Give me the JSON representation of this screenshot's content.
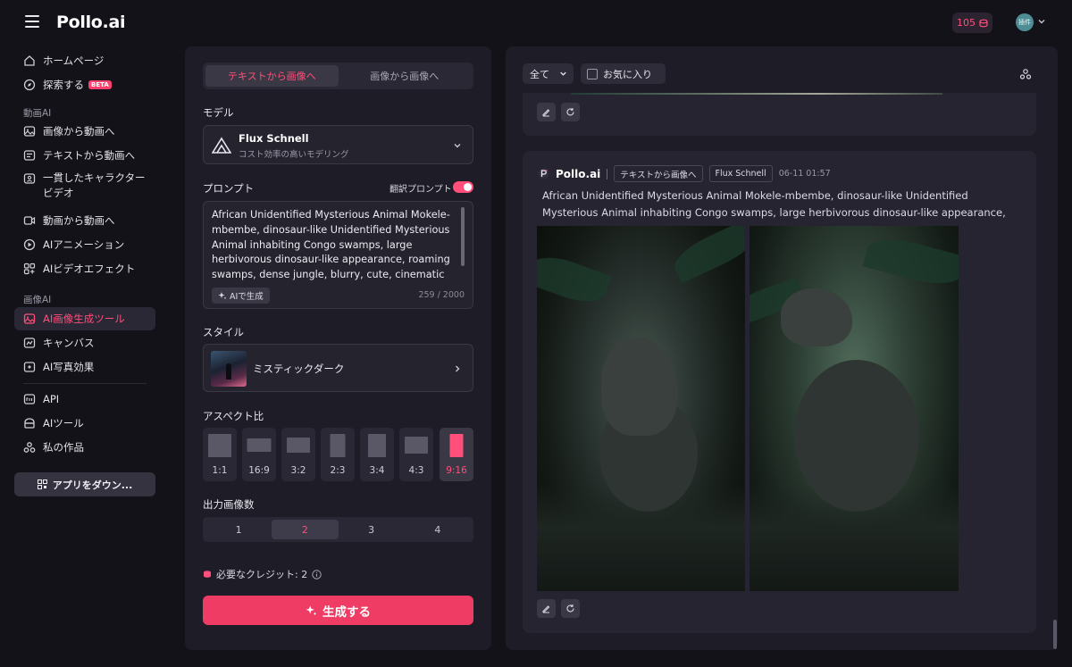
{
  "app": {
    "logo": "Pollo.ai",
    "credits": "105",
    "avatar_text": "插件"
  },
  "sidebar": {
    "items_main": [
      {
        "label": "ホームページ",
        "icon": "home-icon"
      },
      {
        "label": "探索する",
        "icon": "compass-icon",
        "badge": "BETA"
      }
    ],
    "section_video": "動画AI",
    "items_video": [
      {
        "label": "画像から動画へ",
        "icon": "image-to-video-icon"
      },
      {
        "label": "テキストから動画へ",
        "icon": "text-to-video-icon"
      },
      {
        "label": "一貫したキャラクタービデオ",
        "icon": "character-video-icon"
      },
      {
        "label": "動画から動画へ",
        "icon": "video-to-video-icon"
      },
      {
        "label": "AIアニメーション",
        "icon": "animation-icon"
      },
      {
        "label": "AIビデオエフェクト",
        "icon": "effects-icon"
      }
    ],
    "section_image": "画像AI",
    "items_image": [
      {
        "label": "AI画像生成ツール",
        "icon": "image-generator-icon",
        "active": true
      },
      {
        "label": "キャンバス",
        "icon": "canvas-icon"
      },
      {
        "label": "AI写真効果",
        "icon": "photo-effects-icon"
      }
    ],
    "items_bottom": [
      {
        "label": "API",
        "icon": "api-icon"
      },
      {
        "label": "AIツール",
        "icon": "tools-icon"
      },
      {
        "label": "私の作品",
        "icon": "my-works-icon"
      }
    ],
    "download_label": "アプリをダウン..."
  },
  "generator": {
    "tabs": [
      {
        "label": "テキストから画像へ",
        "active": true
      },
      {
        "label": "画像から画像へ",
        "active": false
      }
    ],
    "model_label": "モデル",
    "model_name": "Flux Schnell",
    "model_desc": "コスト効率の高いモデリング",
    "prompt_label": "プロンプト",
    "translate_label": "翻訳プロンプト",
    "translate_on": true,
    "prompt_text": "African Unidentified Mysterious Animal Mokele-mbembe, dinosaur-like Unidentified Mysterious Animal inhabiting Congo swamps, large herbivorous dinosaur-like appearance, roaming swamps, dense jungle, blurry, cute, cinematic",
    "ai_generate_label": "AIで生成",
    "char_count": "259 / 2000",
    "style_label": "スタイル",
    "style_name": "ミスティックダーク",
    "aspect_label": "アスペクト比",
    "aspects": [
      {
        "label": "1:1"
      },
      {
        "label": "16:9"
      },
      {
        "label": "3:2"
      },
      {
        "label": "2:3"
      },
      {
        "label": "3:4"
      },
      {
        "label": "4:3"
      },
      {
        "label": "9:16",
        "active": true
      }
    ],
    "count_label": "出力画像数",
    "counts": [
      "1",
      "2",
      "3",
      "4"
    ],
    "count_selected": "2",
    "credits_required": "必要なクレジット: 2",
    "generate_label": "生成する"
  },
  "results": {
    "filter_all": "全て",
    "filter_fav": "お気に入り",
    "card": {
      "brand": "Pollo.ai",
      "tag_mode": "テキストから画像へ",
      "tag_model": "Flux Schnell",
      "time": "06-11 01:57",
      "prompt": "African Unidentified Mysterious Animal Mokele-mbembe, dinosaur-like Unidentified Mysterious Animal inhabiting Congo swamps, large herbivorous dinosaur-like appearance, roaming swamps,..."
    }
  },
  "colors": {
    "accent": "#ff4f7a",
    "button": "#ee3c65",
    "background": "#131218",
    "panel": "#1e1d27"
  }
}
